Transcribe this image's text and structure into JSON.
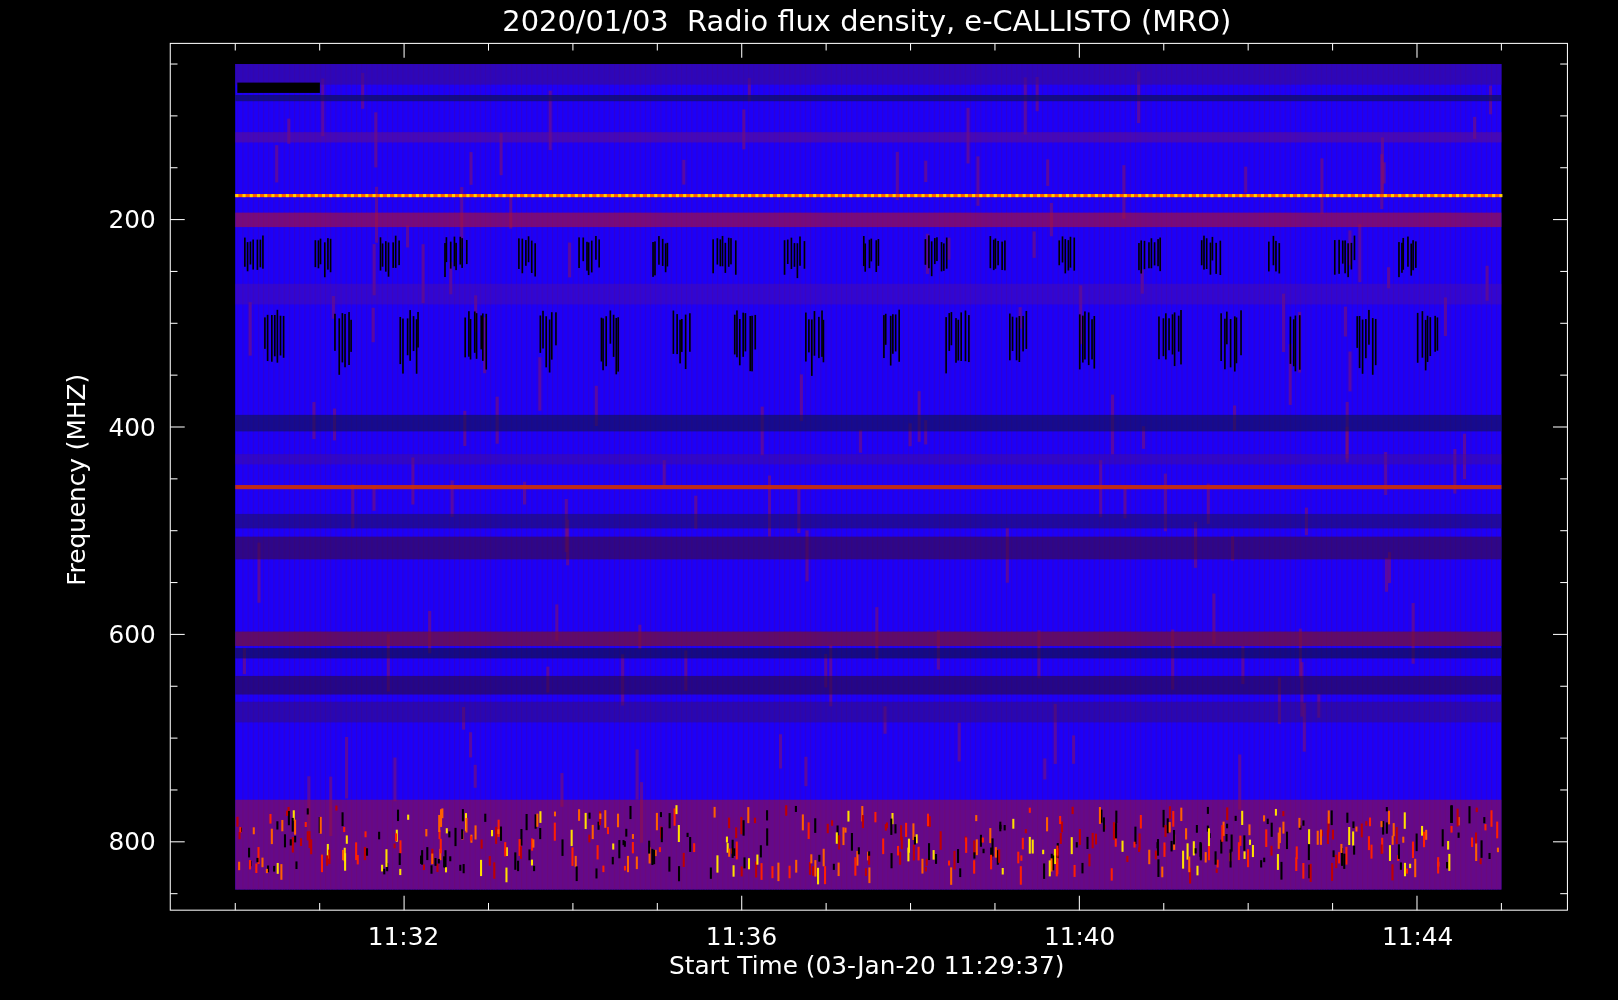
{
  "title": "2020/01/03  Radio flux density, e-CALLISTO (MRO)",
  "ylabel": "Frequency (MHZ)",
  "xlabel": "Start Time (03-Jan-20 11:29:37)",
  "yticks": [
    "200",
    "400",
    "600",
    "800"
  ],
  "xticks": [
    "11:32",
    "11:36",
    "11:40",
    "11:44"
  ]
}
